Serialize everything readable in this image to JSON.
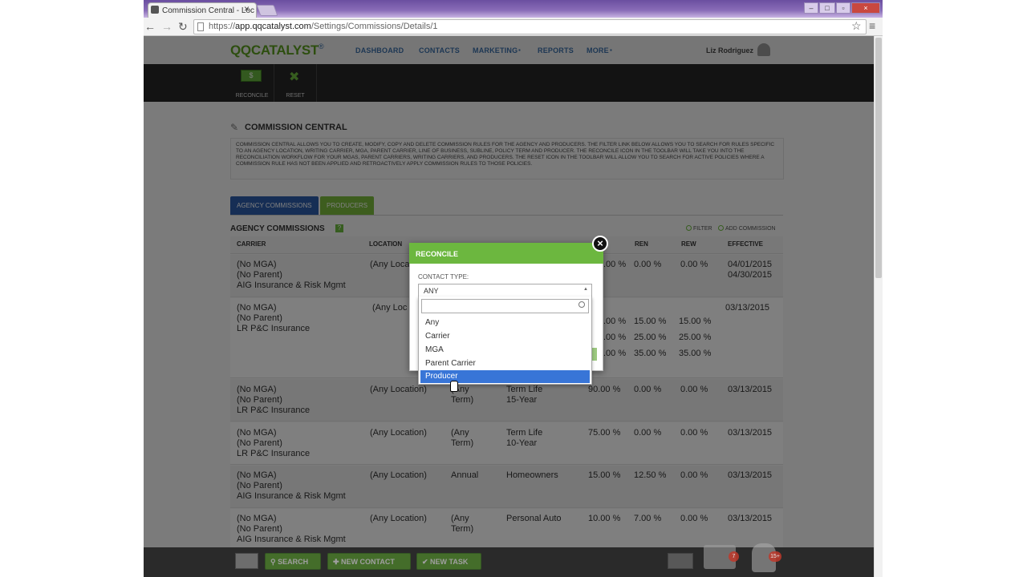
{
  "browser": {
    "tab_title": "Commission Central - Loc",
    "url_prefix": "https://",
    "url_host": "app.qqcatalyst.com",
    "url_path": "/Settings/Commissions/Details/1"
  },
  "app": {
    "logo_main": "QQCATALYST",
    "logo_mark": "®",
    "nav": [
      "DASHBOARD",
      "CONTACTS",
      "MARKETING",
      "REPORTS",
      "MORE"
    ],
    "user_name": "Liz Rodriguez",
    "toolbar": {
      "reconcile_label": "RECONCILE",
      "reset_label": "RESET",
      "reconcile_icon": "$"
    }
  },
  "commission_central": {
    "title": "COMMISSION CENTRAL",
    "description": "Commission Central allows you to create, modify, copy and delete commission rules for the agency and producers. The filter link below allows you to search for rules specific to an agency location, writing carrier, MGA, parent carrier, line of business, subline, policy term and producer. The reconcile icon in the toolbar will take you into the reconciliation workflow for your MGAs, parent carriers, writing carriers, and producers. The reset icon in the toolbar will allow you to search for active policies where a commission rule has not been applied and retroactively apply commission rules to those policies.",
    "tabs": [
      "AGENCY COMMISSIONS",
      "PRODUCERS"
    ],
    "section_title": "AGENCY COMMISSIONS",
    "filter_link": "FILTER",
    "add_link": "ADD COMMISSION",
    "columns": [
      "CARRIER",
      "LOCATION",
      "REN",
      "REW",
      "EFFECTIVE"
    ],
    "rows": [
      {
        "carrier": [
          "(No MGA)",
          "(No Parent)",
          "AIG Insurance & Risk Mgmt"
        ],
        "location": "(Any Locati",
        "term": [
          "",
          ""
        ],
        "lob": [
          "",
          ""
        ],
        "new": ".00 %",
        "ren": "0.00 %",
        "rew": "0.00 %",
        "effective": [
          "04/01/2015",
          "04/30/2015"
        ]
      },
      {
        "carrier": [
          "(No MGA)",
          "(No Parent)",
          "LR P&C Insurance"
        ],
        "location": "(Any Loc",
        "term": [
          "",
          ""
        ],
        "lob": [
          "",
          ""
        ],
        "new": "",
        "ren": "",
        "rew": "",
        "effective": [
          "03/13/2015",
          ""
        ],
        "tiers": [
          {
            "new": ".00 %",
            "ren": "15.00 %",
            "rew": "15.00 %"
          },
          {
            "new": ".00 %",
            "ren": "25.00 %",
            "rew": "25.00 %"
          },
          {
            "new": ".00 %",
            "ren": "35.00 %",
            "rew": "35.00 %"
          }
        ]
      },
      {
        "carrier": [
          "(No MGA)",
          "(No Parent)",
          "LR P&C Insurance"
        ],
        "location": "(Any Location)",
        "term": [
          "(Any",
          "Term)"
        ],
        "lob": [
          "Term Life",
          "15-Year"
        ],
        "new": "90.00 %",
        "ren": "0.00 %",
        "rew": "0.00 %",
        "effective": [
          "03/13/2015",
          ""
        ]
      },
      {
        "carrier": [
          "(No MGA)",
          "(No Parent)",
          "LR P&C Insurance"
        ],
        "location": "(Any Location)",
        "term": [
          "(Any",
          "Term)"
        ],
        "lob": [
          "Term Life",
          "10-Year"
        ],
        "new": "75.00 %",
        "ren": "0.00 %",
        "rew": "0.00 %",
        "effective": [
          "03/13/2015",
          ""
        ]
      },
      {
        "carrier": [
          "(No MGA)",
          "(No Parent)",
          "AIG Insurance & Risk Mgmt"
        ],
        "location": "(Any Location)",
        "term": [
          "Annual",
          ""
        ],
        "lob": [
          "Homeowners",
          ""
        ],
        "new": "15.00 %",
        "ren": "12.50 %",
        "rew": "0.00 %",
        "effective": [
          "03/13/2015",
          ""
        ]
      },
      {
        "carrier": [
          "(No MGA)",
          "(No Parent)",
          "AIG Insurance & Risk Mgmt"
        ],
        "location": "(Any Location)",
        "term": [
          "(Any",
          "Term)"
        ],
        "lob": [
          "Personal Auto",
          ""
        ],
        "new": "10.00 %",
        "ren": "7.00 %",
        "rew": "0.00 %",
        "effective": [
          "03/13/2015",
          ""
        ]
      }
    ]
  },
  "modal": {
    "title": "RECONCILE",
    "close_glyph": "×",
    "contact_type_label": "CONTACT TYPE:",
    "selected_value": "ANY",
    "search_value": "",
    "options": [
      "Any",
      "Carrier",
      "MGA",
      "Parent Carrier",
      "Producer"
    ],
    "highlighted_option": "Producer"
  },
  "bottom_bar": {
    "search_label": "SEARCH",
    "new_contact_label": "NEW CONTACT",
    "new_task_label": "NEW TASK",
    "folder_badge": "7",
    "bell_badge": "15+"
  },
  "colors": {
    "brand_green": "#6cb73f",
    "brand_blue": "#2c5caa",
    "selection_blue": "#3875d7"
  }
}
